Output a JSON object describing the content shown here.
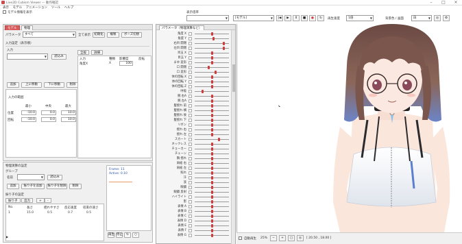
{
  "window": {
    "title": "Live2D Cubism Viewer — 動作確認"
  },
  "menu": [
    "表示",
    "モデル",
    "アニメーション",
    "ツール",
    "ヘルプ"
  ],
  "toolbar": {
    "checkbox_label": "モデル情報を表示"
  },
  "top_controls": {
    "display_label": "表示倍率",
    "model_select": "[モデル]",
    "speed_label": "再生速度",
    "speed_value": "1倍",
    "bg_label": "背景色 / 画面",
    "bg_value": "白"
  },
  "left_panel": {
    "tabs": [
      "モデル",
      "物理"
    ],
    "select_label": "パラメータ",
    "select_value": "すべて",
    "btn_blend": "全て表示",
    "btn_reset": "初期化",
    "btn_copy": "複製",
    "btn_pose": "ポーズ切替",
    "section_input": "入力設定（表示順）",
    "input_label": "入力",
    "input_value": "",
    "btn_read": "読込み",
    "inner_tabs": [
      "全般",
      "詳細"
    ],
    "btn_add": "追加",
    "btn_up": "上に移動",
    "btn_down": "下に移動",
    "btn_del": "削除",
    "table_headers": [
      "入力",
      "種類",
      "影響度",
      "反転"
    ],
    "table_row": [
      "角度X",
      "X",
      "100",
      ""
    ],
    "section_range": "入力の範囲",
    "range_headers": [
      "最小",
      "中央",
      "最大"
    ],
    "range_rows": [
      {
        "label": "位置",
        "min": "-10.0",
        "mid": "0.0",
        "max": "10.0"
      },
      {
        "label": "回転",
        "min": "-10.0",
        "mid": "0.0",
        "max": "10.0"
      }
    ]
  },
  "lower_panel": {
    "section": "物理演算の設定",
    "sub_label": "グループ",
    "select_label": "名前",
    "select_value": "",
    "btn_read": "読込み",
    "btn_add": "追加",
    "btn_copy": "振り子を追加",
    "btn_remove": "振り子を削除",
    "btn_delete": "削除",
    "section_sim": "振り子の設定",
    "sim_tabs": [
      "振り子",
      "出力",
      "+",
      "-"
    ],
    "sim_headers": [
      "No.",
      "長さ",
      "揺れやすさ",
      "反応速度",
      "収束の速さ"
    ],
    "sim_row": [
      "1",
      "15.0",
      "0.5",
      "0.7",
      "0.5"
    ],
    "preview_lines": [
      "Frame: 11",
      "Active: 0.10"
    ],
    "bottom_btns": [
      "再生",
      "停止",
      "",
      ""
    ]
  },
  "param_panel": {
    "header": "パラメータ（物理演算など）",
    "rows": [
      {
        "name": "角度 X",
        "knob": 0.5
      },
      {
        "name": "角度 Y",
        "knob": 0.55
      },
      {
        "name": "右目 開閉",
        "knob": 0.85
      },
      {
        "name": "左目 開閉",
        "knob": 0.85
      },
      {
        "name": "目玉 X",
        "knob": 0.5
      },
      {
        "name": "目玉 Y",
        "knob": 0.5
      },
      {
        "name": "まゆ 変形",
        "knob": 0.5
      },
      {
        "name": "口 開閉",
        "knob": 0.4
      },
      {
        "name": "口 変形",
        "knob": 0.6
      },
      {
        "name": "体の回転 X",
        "knob": 0.5
      },
      {
        "name": "体の回転 Y",
        "knob": 0.5
      },
      {
        "name": "体の回転 Z",
        "knob": 0.5
      },
      {
        "name": "呼吸",
        "knob": 0.2
      },
      {
        "name": "腕 右A",
        "knob": 0.5
      },
      {
        "name": "腕 左A",
        "knob": 0.5
      },
      {
        "name": "髪揺れ 前",
        "knob": 0.5
      },
      {
        "name": "髪揺れ 横",
        "knob": 0.5
      },
      {
        "name": "髪揺れ 後",
        "knob": 0.5
      },
      {
        "name": "髪揺れ 下",
        "knob": 0.5
      },
      {
        "name": "リボン",
        "knob": 0.5
      },
      {
        "name": "揺れ 右",
        "knob": 0.5
      },
      {
        "name": "揺れ 左",
        "knob": 0.5
      },
      {
        "name": "スカート",
        "knob": 0.7
      },
      {
        "name": "ネックレス",
        "knob": 0.5
      },
      {
        "name": "チョーカー",
        "knob": 0.5
      },
      {
        "name": "チェーン",
        "knob": 0.5
      },
      {
        "name": "胸 揺れ",
        "knob": 0.5
      },
      {
        "name": "肩紐 右",
        "knob": 0.5
      },
      {
        "name": "肩紐 左",
        "knob": 0.5
      },
      {
        "name": "照れ",
        "knob": 0.5
      },
      {
        "name": "汗",
        "knob": 0.5
      },
      {
        "name": "涙",
        "knob": 0.5
      },
      {
        "name": "眼鏡",
        "knob": 0.5
      },
      {
        "name": "眼鏡 反射",
        "knob": 0.5
      },
      {
        "name": "ハイライト",
        "knob": 0.5
      },
      {
        "name": "影",
        "knob": 0.5
      },
      {
        "name": "表情 A",
        "knob": 0.5
      },
      {
        "name": "表情 B",
        "knob": 0.5
      },
      {
        "name": "表情 C",
        "knob": 0.5
      },
      {
        "name": "表情 D",
        "knob": 0.5
      },
      {
        "name": "表情 E",
        "knob": 0.5
      },
      {
        "name": "表情 F",
        "knob": 0.5
      },
      {
        "name": "表情 G",
        "knob": 0.5
      }
    ]
  },
  "statusbar": {
    "checkbox_label": "自動再生",
    "zoom": "25%",
    "coords": "[ 20.50 , 18.00 ]"
  },
  "colors": {
    "accent": "#d85a5a",
    "knob": "#d23b3b"
  }
}
